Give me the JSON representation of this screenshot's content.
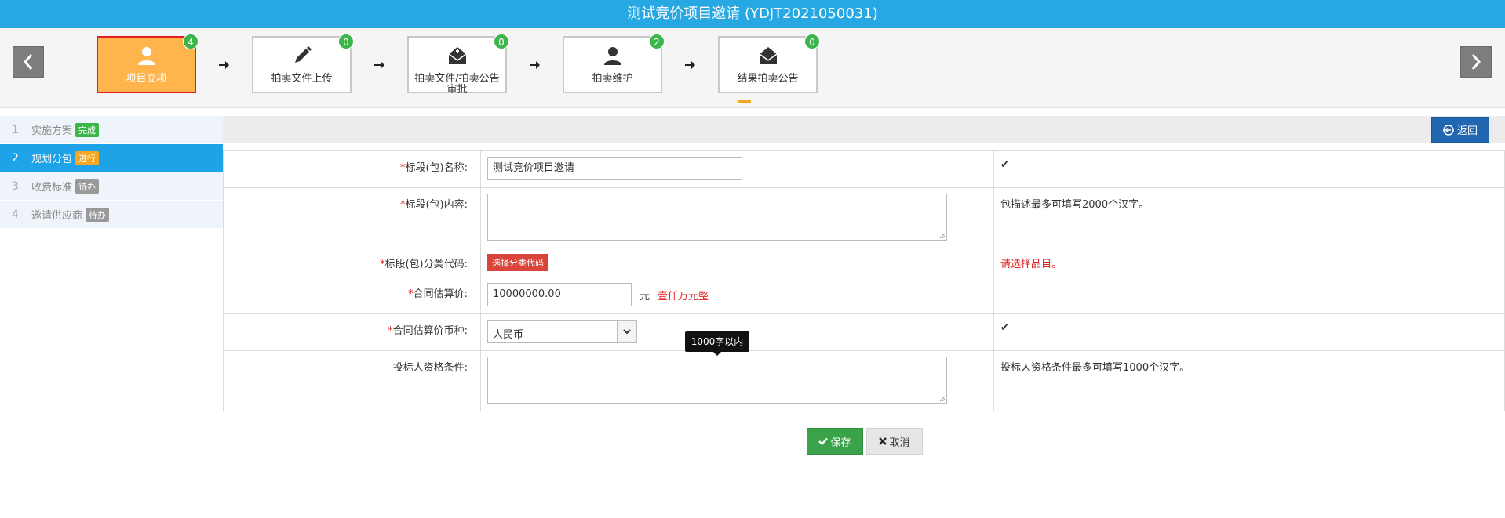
{
  "header": {
    "title": "测试竞价项目邀请 (YDJT2021050031)"
  },
  "workflow": {
    "steps": [
      {
        "label": "项目立项",
        "badge": "4",
        "icon": "user-icon"
      },
      {
        "label": "拍卖文件上传",
        "badge": "0",
        "icon": "pencil-icon"
      },
      {
        "label": "拍卖文件/拍卖公告审批",
        "badge": "0",
        "icon": "envelope-plus-icon"
      },
      {
        "label": "拍卖维护",
        "badge": "2",
        "icon": "user-icon"
      },
      {
        "label": "结果拍卖公告",
        "badge": "0",
        "icon": "envelope-icon"
      }
    ],
    "active_color": "#ffb54c"
  },
  "sidebar": {
    "items": [
      {
        "num": "1",
        "label": "实施方案",
        "status": "完成"
      },
      {
        "num": "2",
        "label": "规划分包",
        "status": "进行"
      },
      {
        "num": "3",
        "label": "收费标准",
        "status": "待办"
      },
      {
        "num": "4",
        "label": "邀请供应商",
        "status": "待办"
      }
    ]
  },
  "actions": {
    "back_label": "返回"
  },
  "form": {
    "name": {
      "label": "标段(包)名称:",
      "value": "测试竞价项目邀请",
      "tip": "✔"
    },
    "content": {
      "label": "标段(包)内容:",
      "value": "",
      "tip": "包描述最多可填写2000个汉字。"
    },
    "category": {
      "label": "标段(包)分类代码:",
      "button": "选择分类代码",
      "tip": "请选择品目。"
    },
    "price": {
      "label": "合同估算价:",
      "value": "10000000.00",
      "unit": "元",
      "amount_cn": "壹仟万元整",
      "tip": ""
    },
    "currency": {
      "label": "合同估算价币种:",
      "value": "人民币",
      "tip": "✔"
    },
    "qualification": {
      "label": "投标人资格条件:",
      "value": "",
      "tip": "投标人资格条件最多可填写1000个汉字。"
    },
    "required_mark": "*"
  },
  "tooltip": {
    "text": "1000字以内"
  },
  "buttons": {
    "save": "保存",
    "cancel": "取消"
  },
  "colors": {
    "title_bar": "#27a8e3",
    "save": "#3aa34a",
    "back": "#2166b0",
    "required": "#e02020"
  }
}
